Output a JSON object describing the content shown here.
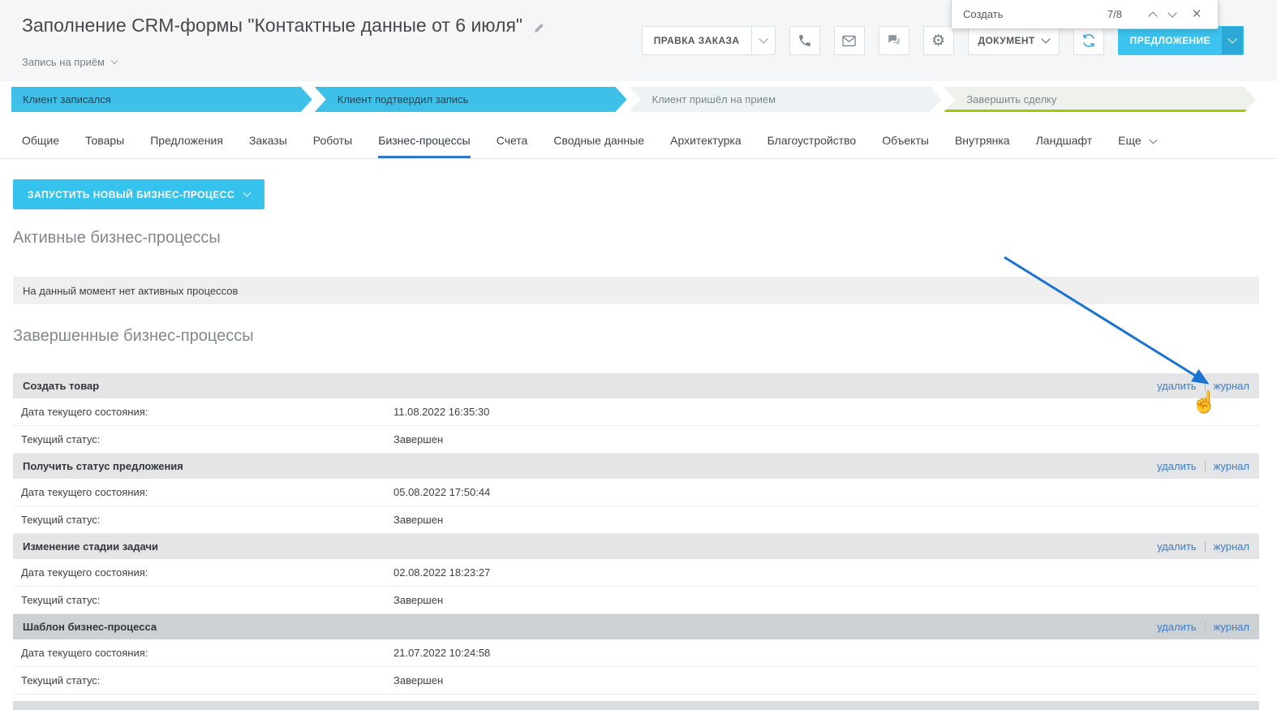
{
  "colors": {
    "accent_cyan": "#35c3ee",
    "stage_done_cyan": "#3fc0e8",
    "stage_final_green": "#9ccb00",
    "link_blue": "#3e7cc4",
    "arrow_blue": "#1a73d1"
  },
  "header": {
    "title": "Заполнение CRM-формы \"Контактные данные от 6 июля\"",
    "subtitle": "Запись на приём"
  },
  "toolbar": {
    "edit_order_label": "ПРАВКА ЗАКАЗА",
    "document_label": "ДОКУМЕНТ",
    "offer_label": "ПРЕДЛОЖЕНИЕ"
  },
  "icons": {
    "gear": "⚙",
    "close": "×",
    "cursor": "☝"
  },
  "find_overlay": {
    "label": "Создать",
    "counter": "7/8"
  },
  "stages": [
    {
      "label": "Клиент записался",
      "state": "done"
    },
    {
      "label": "Клиент подтвердил запись",
      "state": "done"
    },
    {
      "label": "Клиент пришёл на прием",
      "state": "pending"
    },
    {
      "label": "Завершить сделку",
      "state": "final"
    }
  ],
  "tabs": [
    {
      "label": "Общие",
      "state": "normal"
    },
    {
      "label": "Товары",
      "state": "normal"
    },
    {
      "label": "Предложения",
      "state": "normal"
    },
    {
      "label": "Заказы",
      "state": "normal"
    },
    {
      "label": "Роботы",
      "state": "normal"
    },
    {
      "label": "Бизнес-процессы",
      "state": "active"
    },
    {
      "label": "Счета",
      "state": "normal"
    },
    {
      "label": "Сводные данные",
      "state": "normal"
    },
    {
      "label": "Архитектурка",
      "state": "normal"
    },
    {
      "label": "Благоустройство",
      "state": "normal"
    },
    {
      "label": "Объекты",
      "state": "normal"
    },
    {
      "label": "Внутрянка",
      "state": "normal"
    },
    {
      "label": "Ландшафт",
      "state": "normal"
    },
    {
      "label": "Еще",
      "state": "more"
    }
  ],
  "actions": {
    "start_process_label": "ЗАПУСТИТЬ НОВЫЙ БИЗНЕС-ПРОЦЕСС"
  },
  "active_section": {
    "title": "Активные бизнес-процессы",
    "empty_message": "На данный момент нет активных процессов"
  },
  "completed_section": {
    "title": "Завершенные бизнес-процессы",
    "delete_label": "удалить",
    "journal_label": "журнал",
    "date_label": "Дата текущего состояния:",
    "status_label": "Текущий статус:",
    "processes": [
      {
        "name": "Создать товар",
        "date": "11.08.2022 16:35:30",
        "status": "Завершен"
      },
      {
        "name": "Получить статус предложения",
        "date": "05.08.2022 17:50:44",
        "status": "Завершен"
      },
      {
        "name": "Изменение стадии задачи",
        "date": "02.08.2022 18:23:27",
        "status": "Завершен"
      },
      {
        "name": "Шаблон бизнес-процесса",
        "date": "21.07.2022 10:24:58",
        "status": "Завершен"
      }
    ]
  }
}
